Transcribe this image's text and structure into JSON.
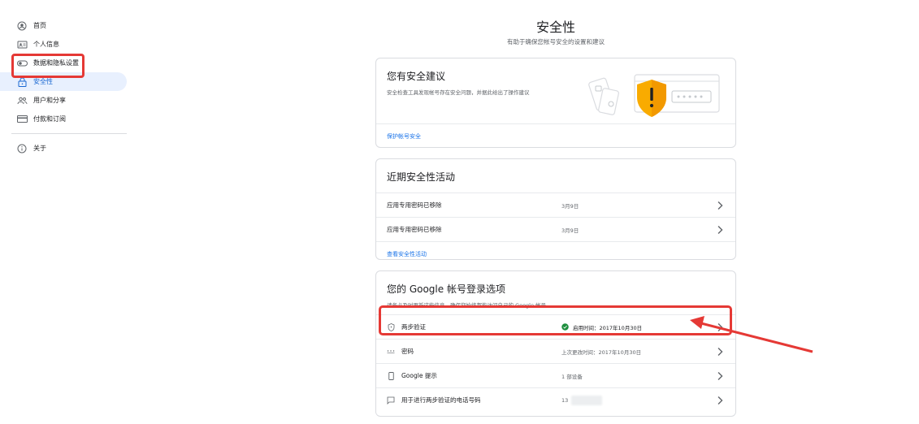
{
  "sidebar": {
    "items": [
      {
        "label": "首页",
        "icon": "account-circle-icon"
      },
      {
        "label": "个人信息",
        "icon": "id-card-icon"
      },
      {
        "label": "数据和隐私设置",
        "icon": "toggle-icon"
      },
      {
        "label": "安全性",
        "icon": "lock-icon"
      },
      {
        "label": "用户和分享",
        "icon": "people-icon"
      },
      {
        "label": "付款和订阅",
        "icon": "credit-card-icon"
      }
    ],
    "about": {
      "label": "关于",
      "icon": "info-icon"
    }
  },
  "header": {
    "title": "安全性",
    "subtitle": "有助于确保您帐号安全的设置和建议"
  },
  "recommendation_card": {
    "title": "您有安全建议",
    "description": "安全检查工具发现帐号存在安全问题，并据此给出了操作建议",
    "link": "保护帐号安全"
  },
  "activity_card": {
    "title": "近期安全性活动",
    "rows": [
      {
        "label": "应用专用密码已移除",
        "value": "3月9日"
      },
      {
        "label": "应用专用密码已移除",
        "value": "3月9日"
      }
    ],
    "link": "查看安全性活动"
  },
  "signin_card": {
    "title": "您的 Google 帐号登录选项",
    "description": "请务必及时更新这些信息，确保您始终都能访问自己的 Google 帐号",
    "rows": [
      {
        "label": "两步验证",
        "value": "启用时间：2017年10月30日",
        "icon": "shield-icon"
      },
      {
        "label": "密码",
        "value": "上次更改时间：2017年10月30日",
        "icon": "password-dots-icon"
      },
      {
        "label": "Google 提示",
        "value": "1 部设备",
        "icon": "phone-icon"
      },
      {
        "label": "用于进行两步验证的电话号码",
        "value": "13",
        "icon": "message-icon"
      }
    ]
  },
  "colors": {
    "accent": "#1a73e8",
    "active_bg": "#e8f0fe",
    "annotation_red": "#e53935",
    "success_green": "#1e8e3e",
    "warning_yellow": "#f9ab00"
  }
}
